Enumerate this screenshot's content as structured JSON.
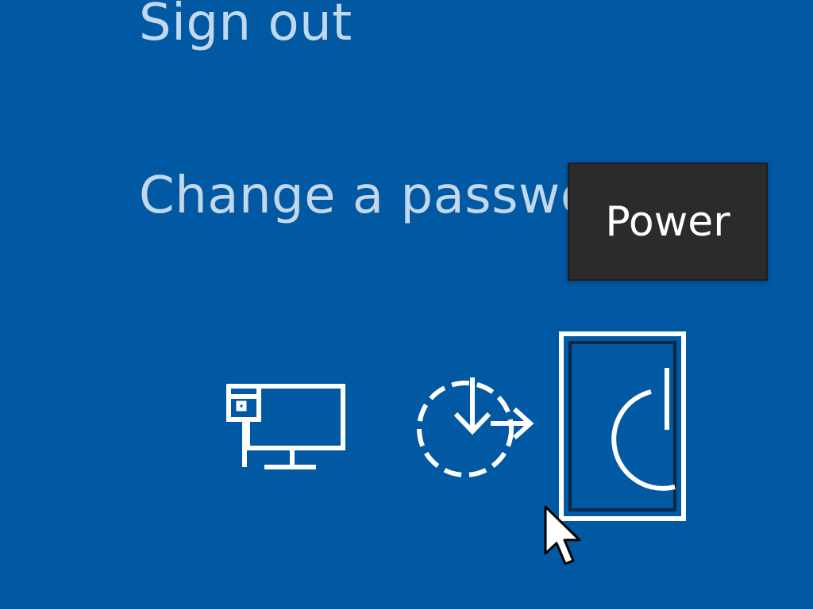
{
  "options": {
    "sign_out": "Sign out",
    "change_password": "Change a password"
  },
  "tooltip": {
    "text": "Power"
  },
  "bottom_icons": [
    {
      "name": "network-icon"
    },
    {
      "name": "ease-of-access-icon"
    },
    {
      "name": "power-icon"
    }
  ],
  "colors": {
    "background": "#0158a3",
    "option_text": "#c2d8ec",
    "tooltip_background": "#2b2b2b",
    "tooltip_text": "#ffffff",
    "icon": "#ffffff"
  }
}
